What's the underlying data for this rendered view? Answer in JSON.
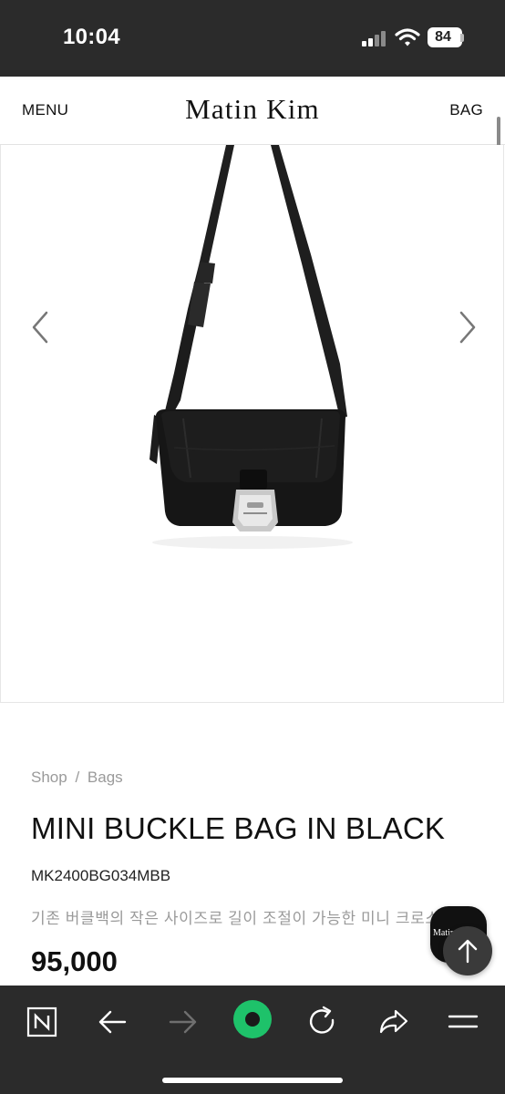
{
  "status_bar": {
    "time": "10:04",
    "battery": "84",
    "icons": [
      "signal-icon",
      "wifi-icon",
      "battery-icon"
    ]
  },
  "header": {
    "menu_label": "MENU",
    "brand": "Matin Kim",
    "bag_label": "BAG"
  },
  "gallery": {
    "image_description_icon": "product-photo",
    "prev_icon": "chevron-left-icon",
    "next_icon": "chevron-right-icon"
  },
  "product": {
    "breadcrumb_shop": "Shop",
    "breadcrumb_separator": "/",
    "breadcrumb_category": "Bags",
    "title": "MINI BUCKLE BAG IN BLACK",
    "code": "MK2400BG034MBB",
    "description": "기존 버클백의 작은 사이즈로 길이 조절이 가능한 미니 크로스",
    "price": "95,000"
  },
  "floating": {
    "chat_label": "Matin",
    "top_icon": "arrow-up-icon"
  },
  "toolbar": {
    "icons": [
      "naver-logo-icon",
      "back-arrow-icon",
      "forward-arrow-icon",
      "green-dot-icon",
      "reload-icon",
      "share-icon",
      "menu-icon"
    ],
    "accent_color": "#1ec26a"
  }
}
